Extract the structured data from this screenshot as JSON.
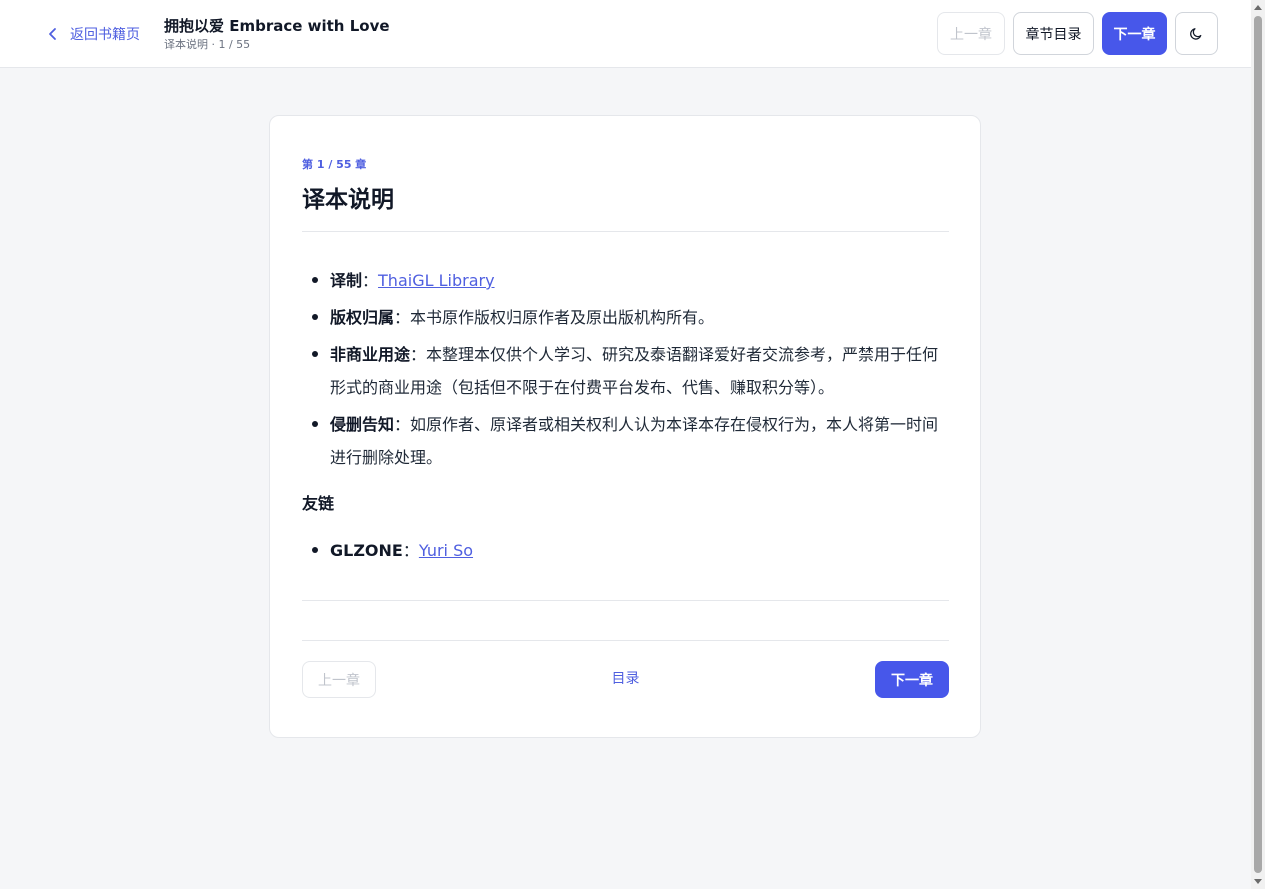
{
  "header": {
    "back_label": "返回书籍页",
    "book_title": "拥抱以爱 Embrace with Love",
    "subtitle": "译本说明 · 1 / 55",
    "prev_label": "上一章",
    "toc_label": "章节目录",
    "next_label": "下一章",
    "theme_icon": "moon-icon"
  },
  "chapter": {
    "tag": "第 1 / 55 章",
    "title": "译本说明"
  },
  "content": {
    "items": [
      {
        "label": "译制",
        "sep": "：",
        "link": "ThaiGL Library"
      },
      {
        "label": "版权归属",
        "sep": "：",
        "text": "本书原作版权归原作者及原出版机构所有。"
      },
      {
        "label": "非商业用途",
        "sep": "：",
        "text": "本整理本仅供个人学习、研究及泰语翻译爱好者交流参考，严禁用于任何形式的商业用途（包括但不限于在付费平台发布、代售、赚取积分等）。"
      },
      {
        "label": "侵删告知",
        "sep": "：",
        "text": "如原作者、原译者或相关权利人认为本译本存在侵权行为，本人将第一时间进行删除处理。"
      }
    ],
    "friend_heading": "友链",
    "friend_items": [
      {
        "label": "GLZONE",
        "sep": "：",
        "link": "Yuri So"
      }
    ]
  },
  "footer": {
    "prev_label": "上一章",
    "toc_label": "目录",
    "next_label": "下一章"
  },
  "colors": {
    "accent": "#4757ea",
    "link": "#4f5fe0",
    "background": "#f5f6f8"
  }
}
